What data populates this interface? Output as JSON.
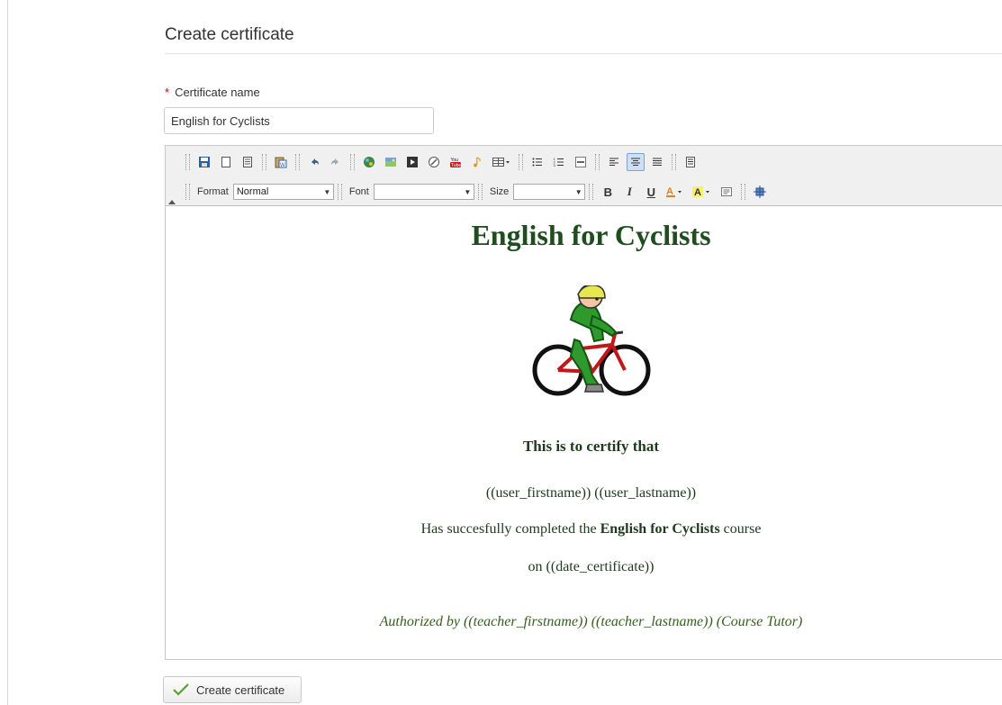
{
  "page": {
    "title": "Create certificate"
  },
  "form": {
    "required_mark": "*",
    "name_label": "Certificate name",
    "name_value": "English for Cyclists"
  },
  "toolbar": {
    "format_label": "Format",
    "format_value": "Normal",
    "font_label": "Font",
    "font_value": "",
    "size_label": "Size",
    "size_value": "",
    "bold": "B",
    "italic": "I",
    "underline": "U",
    "icons_row1": [
      "save-icon",
      "new-page-icon",
      "templates-icon",
      "paste-from-word-icon",
      "undo-icon",
      "redo-icon",
      "image-manager-icon",
      "image-icon",
      "flash-icon",
      "media-icon",
      "youtube-icon",
      "audio-icon",
      "table-icon",
      "bulleted-list-icon",
      "numbered-list-icon",
      "horizontal-rule-icon",
      "align-left-icon",
      "align-center-icon",
      "align-right-icon",
      "source-icon"
    ],
    "icons_row2": [
      "text-color-icon",
      "background-color-icon",
      "templates-small-icon",
      "maximize-icon"
    ]
  },
  "certificate": {
    "title": "English for Cyclists",
    "certify": "This is to certify that",
    "user": "((user_firstname)) ((user_lastname))",
    "completed_pre": "Has succesfully completed the ",
    "completed_course": "English for Cyclists",
    "completed_post": " course",
    "date": "on ((date_certificate))",
    "authorized": "Authorized by ((teacher_firstname)) ((teacher_lastname)) (Course Tutor)"
  },
  "actions": {
    "create_label": "Create certificate"
  },
  "colors": {
    "title_green": "#1e4d1e",
    "required_red": "#cc0000",
    "active_blue": "#cfe0f5"
  }
}
